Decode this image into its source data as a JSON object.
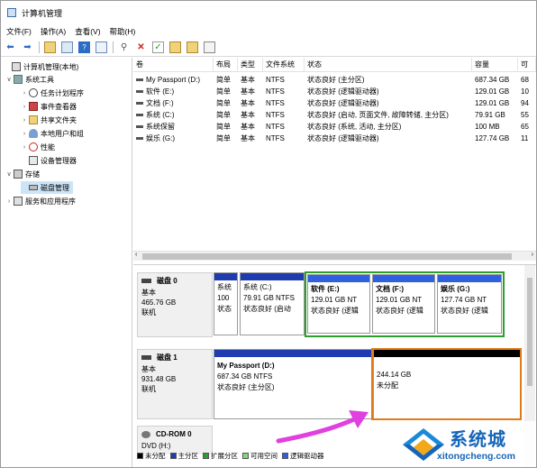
{
  "window": {
    "title": "计算机管理"
  },
  "menu": [
    "文件(F)",
    "操作(A)",
    "查看(V)",
    "帮助(H)"
  ],
  "tree": [
    {
      "label": "计算机管理(本地)",
      "level": 0,
      "arrow": "",
      "icon": "computer-icon"
    },
    {
      "label": "系统工具",
      "level": 1,
      "arrow": "∨",
      "icon": "tools-icon"
    },
    {
      "label": "任务计划程序",
      "level": 2,
      "arrow": "›",
      "icon": "clock-icon"
    },
    {
      "label": "事件查看器",
      "level": 2,
      "arrow": "›",
      "icon": "event-viewer-icon"
    },
    {
      "label": "共享文件夹",
      "level": 2,
      "arrow": "›",
      "icon": "shared-folder-icon"
    },
    {
      "label": "本地用户和组",
      "level": 2,
      "arrow": "›",
      "icon": "users-icon"
    },
    {
      "label": "性能",
      "level": 2,
      "arrow": "›",
      "icon": "performance-icon"
    },
    {
      "label": "设备管理器",
      "level": 2,
      "arrow": "",
      "icon": "device-manager-icon"
    },
    {
      "label": "存储",
      "level": 1,
      "arrow": "∨",
      "icon": "storage-icon"
    },
    {
      "label": "磁盘管理",
      "level": 2,
      "arrow": "",
      "icon": "disk-management-icon",
      "selected": true
    },
    {
      "label": "服务和应用程序",
      "level": 1,
      "arrow": "›",
      "icon": "services-icon"
    }
  ],
  "volume_table": {
    "headers": [
      "卷",
      "布局",
      "类型",
      "文件系统",
      "状态",
      "容量",
      "可"
    ],
    "rows": [
      [
        "My Passport (D:)",
        "简单",
        "基本",
        "NTFS",
        "状态良好 (主分区)",
        "687.34 GB",
        "68"
      ],
      [
        "软件 (E:)",
        "简单",
        "基本",
        "NTFS",
        "状态良好 (逻辑驱动器)",
        "129.01 GB",
        "10"
      ],
      [
        "文档 (F:)",
        "简单",
        "基本",
        "NTFS",
        "状态良好 (逻辑驱动器)",
        "129.01 GB",
        "94"
      ],
      [
        "系统 (C:)",
        "简单",
        "基本",
        "NTFS",
        "状态良好 (启动, 页面文件, 故障转储, 主分区)",
        "79.91 GB",
        "55"
      ],
      [
        "系统保留",
        "简单",
        "基本",
        "NTFS",
        "状态良好 (系统, 活动, 主分区)",
        "100 MB",
        "65"
      ],
      [
        "娱乐 (G:)",
        "简单",
        "基本",
        "NTFS",
        "状态良好 (逻辑驱动器)",
        "127.74 GB",
        "11"
      ]
    ]
  },
  "disks": [
    {
      "name": "磁盘 0",
      "type": "基本",
      "size": "465.76 GB",
      "status": "联机",
      "partitions": [
        {
          "l1": "系统",
          "l2": "100",
          "l3": "状态"
        },
        {
          "l1": "系统 (C:)",
          "l2": "79.91 GB NTFS",
          "l3": "状态良好 (启动"
        },
        {
          "l1": "软件 (E:)",
          "l2": "129.01 GB NT",
          "l3": "状态良好 (逻辑"
        },
        {
          "l1": "文档 (F:)",
          "l2": "129.01 GB NT",
          "l3": "状态良好 (逻辑"
        },
        {
          "l1": "娱乐 (G:)",
          "l2": "127.74 GB NT",
          "l3": "状态良好 (逻辑"
        }
      ]
    },
    {
      "name": "磁盘 1",
      "type": "基本",
      "size": "931.48 GB",
      "status": "联机",
      "partitions": [
        {
          "l1": "My Passport (D:)",
          "l2": "687.34 GB NTFS",
          "l3": "状态良好 (主分区)"
        },
        {
          "l1": "",
          "l2": "244.14 GB",
          "l3": "未分配"
        }
      ]
    },
    {
      "name": "CD-ROM 0",
      "l2": "DVD (H:)"
    }
  ],
  "legend": [
    {
      "label": "未分配",
      "color": "#000000"
    },
    {
      "label": "主分区",
      "color": "#1e3cb0"
    },
    {
      "label": "扩展分区",
      "color": "#2d9d2d"
    },
    {
      "label": "可用空间",
      "color": "#7fd87f"
    },
    {
      "label": "逻辑驱动器",
      "color": "#3060e0"
    }
  ],
  "watermark": {
    "brand": "系统城",
    "url": "xitongcheng.com"
  },
  "colors": {
    "primary_partition": "#1e3cb0",
    "unallocated": "#000000",
    "extended_border": "#2d9d2d",
    "highlight": "#e07b1a",
    "arrow": "#e040e0"
  }
}
